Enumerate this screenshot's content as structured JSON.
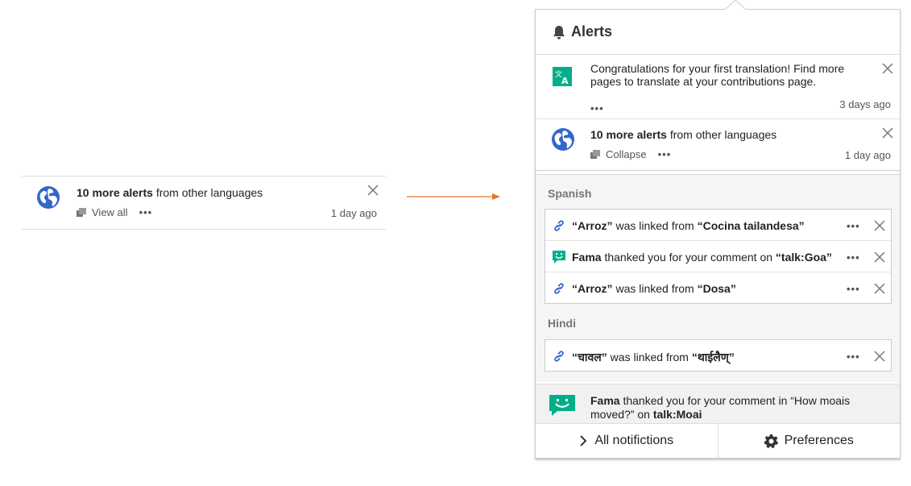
{
  "collapsed_card": {
    "title_bold": "10 more alerts",
    "title_rest": " from other languages",
    "action_label": "View all",
    "more": "•••",
    "time": "1 day ago"
  },
  "panel": {
    "title": "Alerts",
    "notifications": [
      {
        "text": "Congratulations for your first translation! Find more pages to translate at your contributions page.",
        "more": "•••",
        "time": "3 days ago",
        "icon": "translate-icon"
      },
      {
        "title_bold": "10 more alerts",
        "title_rest": " from other languages",
        "action_label": "Collapse",
        "more": "•••",
        "time": "1 day ago",
        "icon": "globe-icon"
      }
    ],
    "groups": [
      {
        "label": "Spanish",
        "items": [
          {
            "b1": "“Arroz”",
            "mid": " was linked from ",
            "b2": "“Cocina tailandesa”",
            "icon": "link-icon",
            "more": "•••"
          },
          {
            "b1": "Fama",
            "mid": " thanked you for your comment on ",
            "b2": "“talk:Goa”",
            "icon": "thanks-icon",
            "more": "•••"
          },
          {
            "b1": "“Arroz”",
            "mid": " was linked from ",
            "b2": "“Dosa”",
            "icon": "link-icon",
            "more": "•••"
          }
        ]
      },
      {
        "label": "Hindi",
        "items": [
          {
            "b1": "“चावल”",
            "mid": " was linked from ",
            "b2": "“थाईलैण्”",
            "icon": "link-icon",
            "more": "•••"
          }
        ]
      }
    ],
    "last_notification": {
      "b1": "Fama",
      "mid": " thanked you for your comment in “How moais moved?” on ",
      "b2": "talk:Moai",
      "icon": "thanks-icon"
    },
    "footer": {
      "all_label": "All notifictions",
      "prefs_label": "Preferences"
    }
  },
  "colors": {
    "globe_blue": "#3366cc",
    "accent_green": "#00af89",
    "link_blue": "#3366cc",
    "arrow_orange": "#e8742c"
  }
}
